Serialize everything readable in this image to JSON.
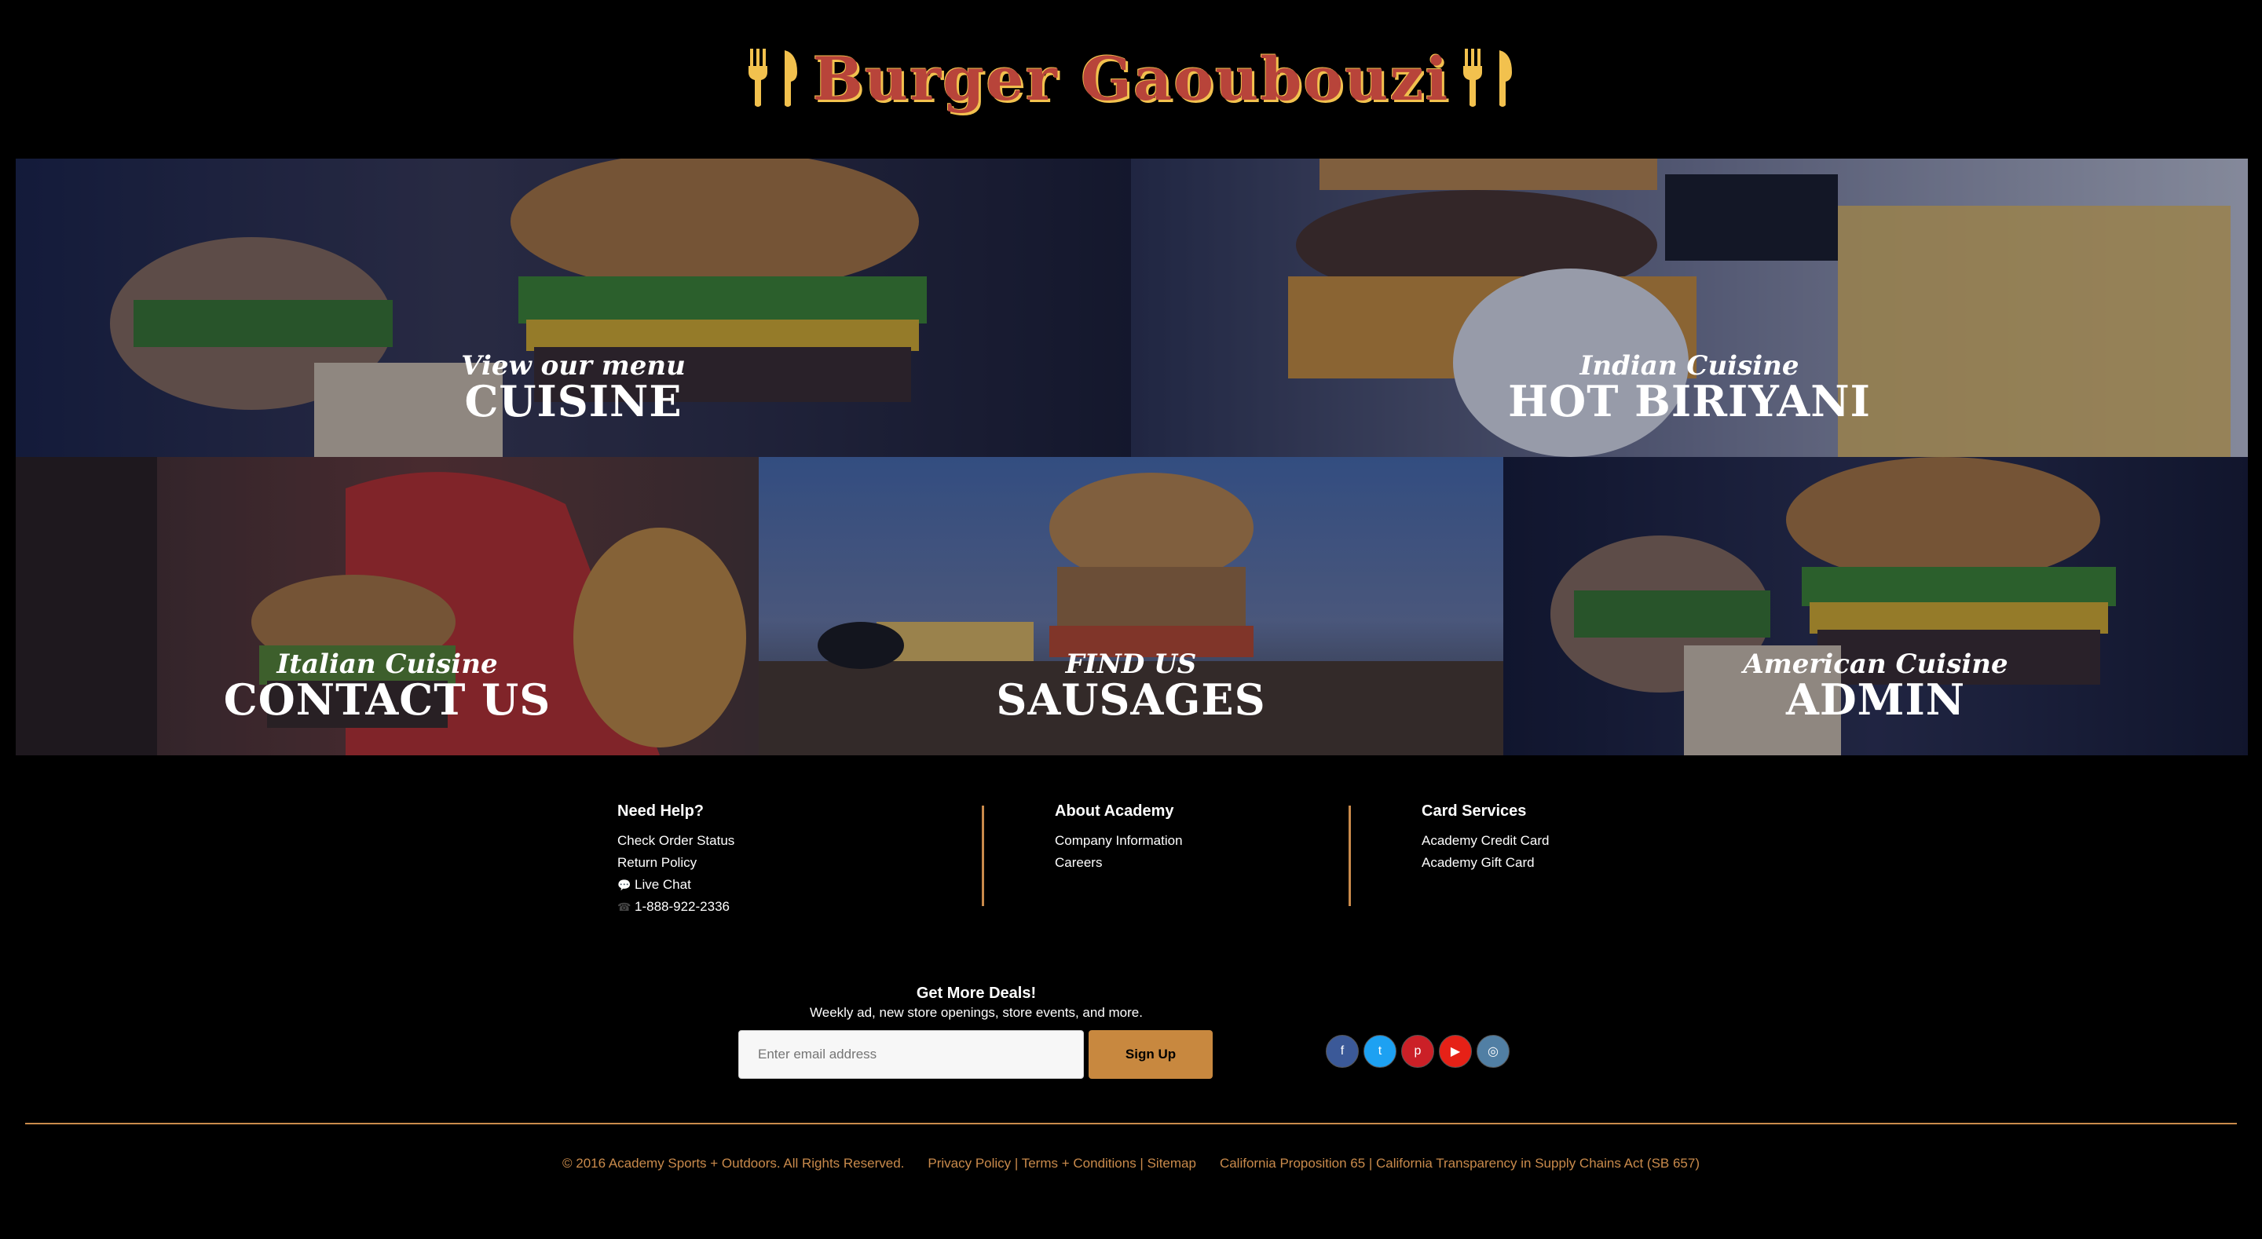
{
  "header": {
    "title": "Burger Gaoubouzi"
  },
  "tiles": [
    {
      "sub": "View our menu",
      "main": "CUISINE"
    },
    {
      "sub": "Indian Cuisine",
      "main": "HOT BIRIYANI"
    },
    {
      "sub": "Italian Cuisine",
      "main": "CONTACT US"
    },
    {
      "sub": "FIND US",
      "main": "SAUSAGES"
    },
    {
      "sub": "American Cuisine",
      "main": "ADMIN"
    }
  ],
  "footer": {
    "help": {
      "heading": "Need Help?",
      "items": [
        "Check Order Status",
        "Return Policy",
        "Live Chat",
        "1-888-922-2336"
      ]
    },
    "about": {
      "heading": "About Academy",
      "items": [
        "Company Information",
        "Careers"
      ]
    },
    "card": {
      "heading": "Card Services",
      "items": [
        "Academy Credit Card",
        "Academy Gift Card"
      ]
    }
  },
  "deals": {
    "title": "Get More Deals!",
    "subtitle": "Weekly ad, new store openings, store events, and more.",
    "email_placeholder": "Enter email address",
    "signup_label": "Sign Up"
  },
  "social": [
    {
      "name": "facebook-icon",
      "glyph": "f",
      "color": "#3b5998"
    },
    {
      "name": "twitter-icon",
      "glyph": "t",
      "color": "#1da1f2"
    },
    {
      "name": "pinterest-icon",
      "glyph": "p",
      "color": "#cb2027"
    },
    {
      "name": "youtube-icon",
      "glyph": "▶",
      "color": "#e62117"
    },
    {
      "name": "instagram-icon",
      "glyph": "◎",
      "color": "#517fa4"
    }
  ],
  "bottom": {
    "copyright": "© 2016 Academy Sports + Outdoors. All Rights Reserved.",
    "legal": "Privacy Policy | Terms + Conditions | Sitemap",
    "prop": "California Proposition 65 | California Transparency in Supply Chains Act (SB 657)"
  },
  "colors": {
    "accent": "#c98a4b",
    "logo": "#b8443a",
    "logo_shadow": "#f2c14e"
  }
}
